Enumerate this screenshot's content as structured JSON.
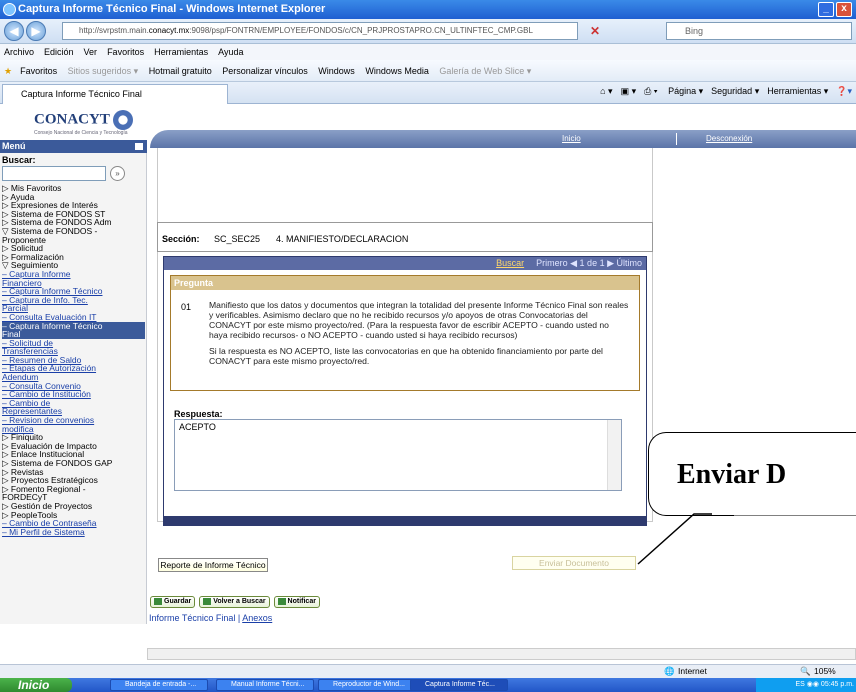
{
  "window": {
    "title": "Captura Informe Técnico Final - Windows Internet Explorer"
  },
  "address": {
    "prefix": "http://svrpstm.main.",
    "domain": "conacyt.mx",
    "path": ":9098/psp/FONTRN/EMPLOYEE/FONDOS/c/CN_PRJPROSTAPRO.CN_ULTINFTEC_CMP.GBL",
    "search_placeholder": "Bing"
  },
  "menubar": [
    "Archivo",
    "Edición",
    "Ver",
    "Favoritos",
    "Herramientas",
    "Ayuda"
  ],
  "favorites": {
    "label": "Favoritos",
    "items": [
      "Sitios sugeridos ▾",
      "Hotmail gratuito",
      "Personalizar vínculos",
      "Windows",
      "Windows Media",
      "Galería de Web Slice ▾"
    ]
  },
  "tab": {
    "label": "Captura Informe Técnico Final"
  },
  "tools": [
    "Página ▾",
    "Seguridad ▾",
    "Herramientas ▾"
  ],
  "header": {
    "logo": "CONACYT",
    "logo_sub": "Consejo Nacional de Ciencia y Tecnología",
    "links": {
      "inicio": "Inicio",
      "desconexion": "Desconexión"
    }
  },
  "sidebar": {
    "title": "Menú",
    "search_label": "Buscar:",
    "search_go": "»",
    "items": [
      {
        "text": "▷ Mis Favoritos",
        "style": ""
      },
      {
        "text": "▷ Ayuda",
        "style": ""
      },
      {
        "text": "▷ Expresiones de Interés",
        "style": ""
      },
      {
        "text": "▷ Sistema de FONDOS ST",
        "style": ""
      },
      {
        "text": "▷ Sistema de FONDOS Adm",
        "style": ""
      },
      {
        "text": "▽ Sistema de FONDOS -",
        "style": ""
      },
      {
        "text": "   Proponente",
        "style": ""
      },
      {
        "text": "   ▷ Solicitud",
        "style": ""
      },
      {
        "text": "   ▷ Formalización",
        "style": ""
      },
      {
        "text": "   ▽ Seguimiento",
        "style": ""
      },
      {
        "text": "      – Captura Informe",
        "style": "u"
      },
      {
        "text": "         Financiero",
        "style": "u"
      },
      {
        "text": "      – Captura Informe Técnico",
        "style": "u"
      },
      {
        "text": "      – Captura de Info. Tec.",
        "style": "u"
      },
      {
        "text": "         Parcial",
        "style": "u"
      },
      {
        "text": "      – Consulta Evaluación IT",
        "style": "u"
      },
      {
        "text": "      – Captura Informe Técnico",
        "style": "sel"
      },
      {
        "text": "         Final",
        "style": "sel"
      },
      {
        "text": "      – Solicitud de",
        "style": "u"
      },
      {
        "text": "         Transferencias",
        "style": "u"
      },
      {
        "text": "      – Resumen de Saldo",
        "style": "u"
      },
      {
        "text": "      – Etapas de Autorización",
        "style": "u"
      },
      {
        "text": "         Adendum",
        "style": "u"
      },
      {
        "text": "      – Consulta Convenio",
        "style": "u"
      },
      {
        "text": "      – Cambio de Institución",
        "style": "u"
      },
      {
        "text": "      – Cambio de",
        "style": "u"
      },
      {
        "text": "         Representantes",
        "style": "u"
      },
      {
        "text": "      – Revision de convenios",
        "style": "u"
      },
      {
        "text": "         modifica",
        "style": "u"
      },
      {
        "text": "   ▷ Finiquito",
        "style": ""
      },
      {
        "text": "   ▷ Evaluación de Impacto",
        "style": ""
      },
      {
        "text": "   ▷ Enlace Institucional",
        "style": ""
      },
      {
        "text": "▷ Sistema de FONDOS GAP",
        "style": ""
      },
      {
        "text": "▷ Revistas",
        "style": ""
      },
      {
        "text": "▷ Proyectos Estratégicos",
        "style": ""
      },
      {
        "text": "▷ Fomento Regional -",
        "style": ""
      },
      {
        "text": "   FORDECyT",
        "style": ""
      },
      {
        "text": "▷ Gestión de Proyectos",
        "style": ""
      },
      {
        "text": "▷ PeopleTools",
        "style": ""
      },
      {
        "text": "– Cambio de Contraseña",
        "style": "u"
      },
      {
        "text": "– Mi Perfil de Sistema",
        "style": "u"
      }
    ]
  },
  "section": {
    "label": "Sección:",
    "code": "SC_SEC25",
    "name": "4. MANIFIESTO/DECLARACION"
  },
  "grid": {
    "buscar": "Buscar",
    "paging": "Primero ◀ 1 de 1 ▶ Último"
  },
  "pregunta": {
    "header": "Pregunta",
    "number": "01",
    "text1": "Manifiesto que los datos y documentos que integran la totalidad del presente Informe Técnico Final son reales y verificables. Asimismo declaro que no he recibido recursos y/o apoyos de otras Convocatorias del CONACYT por este mismo proyecto/red. (Para la respuesta favor de escribir ACEPTO - cuando usted no haya recibido recursos- o NO ACEPTO - cuando usted si haya recibido recursos)",
    "text2": "Si la respuesta es NO ACEPTO, liste las convocatorias en que ha obtenido financiamiento por parte del CONACYT para este mismo proyecto/red."
  },
  "respuesta": {
    "label": "Respuesta:",
    "value": "ACEPTO"
  },
  "buttons": {
    "reporte": "Reporte de Informe Técnico",
    "enviar": "Enviar Documento",
    "guardar": "Guardar",
    "volver": "Volver a Buscar",
    "notificar": "Notificar"
  },
  "footer_links": {
    "current": "Informe Técnico Final",
    "separator": " | ",
    "anexos": "Anexos"
  },
  "callout": {
    "text": "Enviar D"
  },
  "status": {
    "zone": "Internet",
    "zoom": "105%"
  },
  "taskbar": {
    "start": "Inicio",
    "tasks": [
      "Bandeja de entrada -...",
      "Manual Informe Técni...",
      "Reproductor de Wind...",
      "Captura Informe Téc..."
    ],
    "lang": "ES",
    "time": "05:45 p.m."
  }
}
